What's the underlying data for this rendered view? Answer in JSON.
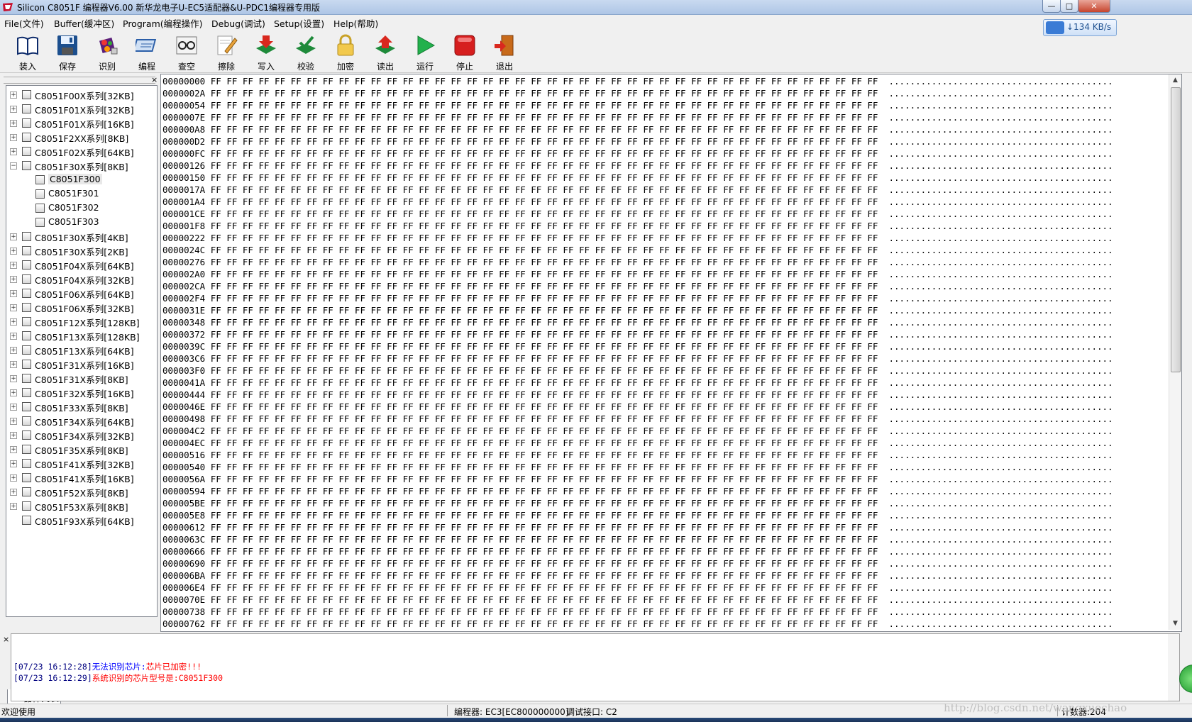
{
  "window": {
    "title": "Silicon C8051F 编程器V6.00  新华龙电子U-EC5适配器&U-PDC1编程器专用版",
    "min_glyph": "—",
    "max_glyph": "□",
    "close_glyph": "✕"
  },
  "menu": [
    "File(文件)",
    "Buffer(缓冲区)",
    "Program(编程操作)",
    "Debug(调试)",
    "Setup(设置)",
    "Help(帮助)"
  ],
  "speed_indicator": {
    "text": "↓134 KB/s"
  },
  "toolbar": [
    {
      "label": "装入",
      "icon": "book-icon"
    },
    {
      "label": "保存",
      "icon": "floppy-disk-icon"
    },
    {
      "label": "识别",
      "icon": "chip-identify-icon"
    },
    {
      "label": "编程",
      "icon": "program-icon"
    },
    {
      "label": "查空",
      "icon": "glasses-icon"
    },
    {
      "label": "擦除",
      "icon": "eraser-icon"
    },
    {
      "label": "写入",
      "icon": "write-arrow-icon"
    },
    {
      "label": "校验",
      "icon": "verify-icon"
    },
    {
      "label": "加密",
      "icon": "lock-icon"
    },
    {
      "label": "读出",
      "icon": "read-arrow-icon"
    },
    {
      "label": "运行",
      "icon": "run-play-icon"
    },
    {
      "label": "停止",
      "icon": "stop-icon"
    },
    {
      "label": "退出",
      "icon": "exit-door-icon"
    }
  ],
  "device_tree": {
    "close_glyph": "×",
    "tab_label": "器件列表",
    "items": [
      {
        "label": "C8051F00X系列[32KB]",
        "expanded": false
      },
      {
        "label": "C8051F01X系列[32KB]",
        "expanded": false
      },
      {
        "label": "C8051F01X系列[16KB]",
        "expanded": false
      },
      {
        "label": "C8051F2XX系列[8KB]",
        "expanded": false
      },
      {
        "label": "C8051F02X系列[64KB]",
        "expanded": false
      },
      {
        "label": "C8051F30X系列[8KB]",
        "expanded": true,
        "children": [
          {
            "label": "C8051F300",
            "selected": true
          },
          {
            "label": "C8051F301"
          },
          {
            "label": "C8051F302"
          },
          {
            "label": "C8051F303"
          }
        ]
      },
      {
        "label": "C8051F30X系列[4KB]",
        "expanded": false
      },
      {
        "label": "C8051F30X系列[2KB]",
        "expanded": false
      },
      {
        "label": "C8051F04X系列[64KB]",
        "expanded": false
      },
      {
        "label": "C8051F04X系列[32KB]",
        "expanded": false
      },
      {
        "label": "C8051F06X系列[64KB]",
        "expanded": false
      },
      {
        "label": "C8051F06X系列[32KB]",
        "expanded": false
      },
      {
        "label": "C8051F12X系列[128KB]",
        "expanded": false
      },
      {
        "label": "C8051F13X系列[128KB]",
        "expanded": false
      },
      {
        "label": "C8051F13X系列[64KB]",
        "expanded": false
      },
      {
        "label": "C8051F31X系列[16KB]",
        "expanded": false
      },
      {
        "label": "C8051F31X系列[8KB]",
        "expanded": false
      },
      {
        "label": "C8051F32X系列[16KB]",
        "expanded": false
      },
      {
        "label": "C8051F33X系列[8KB]",
        "expanded": false
      },
      {
        "label": "C8051F34X系列[64KB]",
        "expanded": false
      },
      {
        "label": "C8051F34X系列[32KB]",
        "expanded": false
      },
      {
        "label": "C8051F35X系列[8KB]",
        "expanded": false
      },
      {
        "label": "C8051F41X系列[32KB]",
        "expanded": false
      },
      {
        "label": "C8051F41X系列[16KB]",
        "expanded": false
      },
      {
        "label": "C8051F52X系列[8KB]",
        "expanded": false
      },
      {
        "label": "C8051F53X系列[8KB]",
        "expanded": false
      },
      {
        "label": "C8051F93X系列[64KB]",
        "expanded": false
      }
    ]
  },
  "hex_view": {
    "byte_value": "FF",
    "bytes_per_row": 42,
    "ascii_text": "..........................................",
    "addresses": [
      "00000000",
      "0000002A",
      "00000054",
      "0000007E",
      "000000A8",
      "000000D2",
      "000000FC",
      "00000126",
      "00000150",
      "0000017A",
      "000001A4",
      "000001CE",
      "000001F8",
      "00000222",
      "0000024C",
      "00000276",
      "000002A0",
      "000002CA",
      "000002F4",
      "0000031E",
      "00000348",
      "00000372",
      "0000039C",
      "000003C6",
      "000003F0",
      "0000041A",
      "00000444",
      "0000046E",
      "00000498",
      "000004C2",
      "000004EC",
      "00000516",
      "00000540",
      "0000056A",
      "00000594",
      "000005BE",
      "000005E8",
      "00000612",
      "0000063C",
      "00000666",
      "00000690",
      "000006BA",
      "000006E4",
      "0000070E",
      "00000738",
      "00000762"
    ],
    "scroll_up_glyph": "▲",
    "scroll_down_glyph": "▼"
  },
  "log": {
    "close_glyph": "×",
    "lines": [
      {
        "time": "[07/23 16:12:28]",
        "msg1": "无法识别芯片:",
        "msg2": "芯片已加密!!!"
      },
      {
        "time": "[07/23 16:12:29]",
        "msg1": "系统识别的芯片型号是:",
        "msg2": "C8051F300"
      }
    ]
  },
  "status": {
    "left": "欢迎使用",
    "programmer": "编程器: EC3[EC800000000]",
    "interface": "调试接口: C2",
    "counter": "计数器:204"
  },
  "watermark": "http://blog.csdn.net/wangxuechao",
  "colors": {
    "log_time": "#00007f",
    "log_blue": "#0000ff",
    "log_red": "#ff0000"
  }
}
